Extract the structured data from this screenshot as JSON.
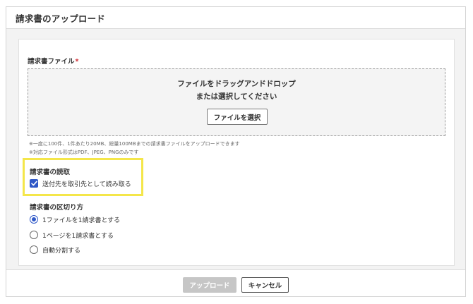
{
  "dialog": {
    "title": "請求書のアップロード"
  },
  "upload": {
    "label": "請求書ファイル",
    "required_mark": "*",
    "drop_line1": "ファイルをドラッグアンドドロップ",
    "drop_line2": "または選択してください",
    "select_button": "ファイルを選択",
    "note1": "※一度に100件、1件あたり20MB、総量100MBまでの請求書ファイルをアップロードできます",
    "note2": "※対応ファイル形式はPDF、JPEG、PNGのみです"
  },
  "reading": {
    "label": "請求書の読取",
    "checkbox_label": "送付先を取引先として読み取る",
    "checked": true
  },
  "split": {
    "label": "請求書の区切り方",
    "options": [
      {
        "label": "1ファイルを1請求書とする",
        "selected": true
      },
      {
        "label": "1ページを1請求書とする",
        "selected": false
      },
      {
        "label": "自動分割する",
        "selected": false
      }
    ]
  },
  "footer": {
    "upload_button": "アップロード",
    "cancel_button": "キャンセル"
  },
  "colors": {
    "accent": "#2f58c7",
    "highlight": "#f4e64a",
    "required": "#d0282f",
    "disabled_button": "#c6c6c6"
  },
  "icons": {
    "checkbox": "checkmark-icon"
  }
}
